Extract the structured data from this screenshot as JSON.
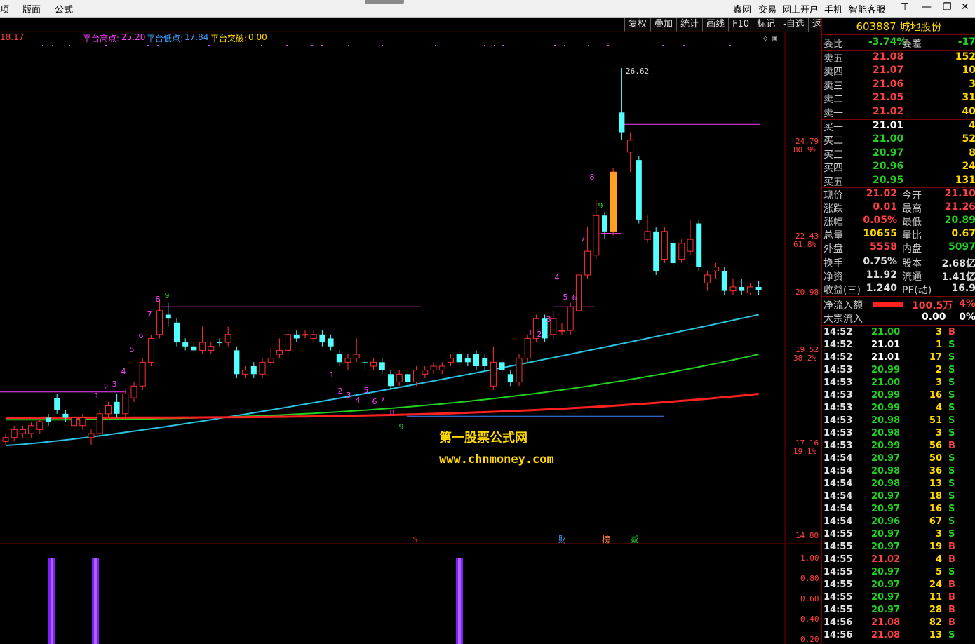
{
  "menu": {
    "items": [
      "项",
      "版面",
      "公式"
    ],
    "right_items": [
      "鑫网",
      "交易",
      "网上开户",
      "手机",
      "智能客服"
    ],
    "win_icons": [
      "pin-icon",
      "minimize-icon",
      "restore-icon",
      "close-icon"
    ]
  },
  "toolbar": {
    "buttons": [
      "复权",
      "叠加",
      "统计",
      "画线",
      "F10",
      "标记",
      "-自选",
      "返回"
    ]
  },
  "legend": {
    "first_value": "18.17",
    "high_label": "平台高点:",
    "high_value": "25.20",
    "low_label": "平台低点:",
    "low_value": "17.84",
    "break_label": "平台突破:",
    "break_value": "0.00"
  },
  "price_axis": [
    {
      "price": "24.79",
      "pct": "80.9%"
    },
    {
      "price": "22.43",
      "pct": "61.8%"
    },
    {
      "price": "20.98",
      "pct": ""
    },
    {
      "price": "19.52",
      "pct": "38.2%"
    },
    {
      "price": "17.16",
      "pct": "19.1%"
    },
    {
      "price": "14.80",
      "pct": ""
    }
  ],
  "indicator_axis": [
    "1.00",
    "0.80",
    "0.60",
    "0.40",
    "0.20"
  ],
  "chart_labels": {
    "peak": "26.62",
    "events": [
      "$",
      "财",
      "榜",
      "减"
    ]
  },
  "watermark": {
    "line1": "第一股票公式网",
    "line2": "www.chnmoney.com"
  },
  "chart_data": {
    "type": "candlestick",
    "price_range": [
      14.8,
      26.62
    ],
    "peak_high": 26.62,
    "reference_levels": [
      25.2,
      21.02,
      17.84
    ],
    "moving_averages": [
      {
        "color": "#2ac3e0",
        "approx_end": 20.4
      },
      {
        "color": "#22d022",
        "approx_end": 19.4
      },
      {
        "color": "#ff2020",
        "approx_end": 18.4
      }
    ],
    "candles": [
      {
        "o": 17.2,
        "c": 17.3,
        "h": 17.4,
        "l": 17.1,
        "up": true
      },
      {
        "o": 17.3,
        "c": 17.5,
        "h": 17.6,
        "l": 17.2,
        "up": true
      },
      {
        "o": 17.5,
        "c": 17.4,
        "h": 17.6,
        "l": 17.3,
        "up": true
      },
      {
        "o": 17.4,
        "c": 17.6,
        "h": 17.7,
        "l": 17.3,
        "up": true
      },
      {
        "o": 17.5,
        "c": 17.7,
        "h": 17.8,
        "l": 17.4,
        "up": true
      },
      {
        "o": 17.7,
        "c": 17.8,
        "h": 17.9,
        "l": 17.6,
        "up": false
      },
      {
        "o": 18.3,
        "c": 18.0,
        "h": 18.4,
        "l": 17.9,
        "up": false
      },
      {
        "o": 17.9,
        "c": 17.8,
        "h": 18.0,
        "l": 17.7,
        "up": false
      },
      {
        "o": 17.6,
        "c": 17.8,
        "h": 17.9,
        "l": 17.4,
        "up": true
      },
      {
        "o": 17.6,
        "c": 17.8,
        "h": 17.9,
        "l": 17.5,
        "up": true
      },
      {
        "o": 17.4,
        "c": 17.3,
        "h": 17.5,
        "l": 17.1,
        "up": true
      },
      {
        "o": 17.4,
        "c": 17.9,
        "h": 18.0,
        "l": 17.3,
        "up": true
      },
      {
        "o": 17.9,
        "c": 18.1,
        "h": 18.2,
        "l": 17.8,
        "up": true
      },
      {
        "o": 17.9,
        "c": 18.2,
        "h": 18.4,
        "l": 17.8,
        "up": false
      },
      {
        "o": 17.9,
        "c": 18.4,
        "h": 18.5,
        "l": 17.8,
        "up": true
      },
      {
        "o": 18.3,
        "c": 18.6,
        "h": 18.7,
        "l": 18.2,
        "up": true
      },
      {
        "o": 18.6,
        "c": 19.2,
        "h": 19.3,
        "l": 18.5,
        "up": true
      },
      {
        "o": 19.2,
        "c": 19.8,
        "h": 19.9,
        "l": 19.1,
        "up": true
      },
      {
        "o": 19.9,
        "c": 20.5,
        "h": 20.8,
        "l": 19.8,
        "up": true
      },
      {
        "o": 20.4,
        "c": 20.3,
        "h": 20.7,
        "l": 20.1,
        "up": false
      },
      {
        "o": 20.2,
        "c": 19.7,
        "h": 20.3,
        "l": 19.6,
        "up": false
      },
      {
        "o": 19.7,
        "c": 19.6,
        "h": 19.8,
        "l": 19.5,
        "up": false
      },
      {
        "o": 19.5,
        "c": 19.6,
        "h": 19.7,
        "l": 19.4,
        "up": false
      },
      {
        "o": 19.5,
        "c": 19.7,
        "h": 20.1,
        "l": 19.4,
        "up": true
      },
      {
        "o": 19.5,
        "c": 19.6,
        "h": 19.7,
        "l": 19.4,
        "up": true
      },
      {
        "o": 19.7,
        "c": 19.7,
        "h": 19.8,
        "l": 19.6,
        "up": false
      },
      {
        "o": 19.7,
        "c": 19.9,
        "h": 20.1,
        "l": 19.6,
        "up": true
      },
      {
        "o": 19.5,
        "c": 18.9,
        "h": 19.6,
        "l": 18.8,
        "up": false
      },
      {
        "o": 18.9,
        "c": 19.0,
        "h": 19.1,
        "l": 18.8,
        "up": true
      },
      {
        "o": 19.1,
        "c": 18.9,
        "h": 19.2,
        "l": 18.8,
        "up": false
      },
      {
        "o": 18.9,
        "c": 19.2,
        "h": 19.3,
        "l": 18.8,
        "up": true
      },
      {
        "o": 19.3,
        "c": 19.2,
        "h": 19.6,
        "l": 19.1,
        "up": true
      },
      {
        "o": 19.5,
        "c": 19.4,
        "h": 19.8,
        "l": 19.3,
        "up": true
      },
      {
        "o": 19.9,
        "c": 19.5,
        "h": 20.0,
        "l": 19.3,
        "up": true
      },
      {
        "o": 19.8,
        "c": 19.9,
        "h": 20.0,
        "l": 19.7,
        "up": false
      },
      {
        "o": 19.9,
        "c": 19.9,
        "h": 20.0,
        "l": 19.8,
        "up": true
      },
      {
        "o": 19.8,
        "c": 19.9,
        "h": 20.0,
        "l": 19.7,
        "up": true
      },
      {
        "o": 19.9,
        "c": 19.7,
        "h": 20.0,
        "l": 19.6,
        "up": false
      },
      {
        "o": 19.8,
        "c": 19.6,
        "h": 19.9,
        "l": 19.5,
        "up": false
      },
      {
        "o": 19.4,
        "c": 19.2,
        "h": 19.5,
        "l": 19.1,
        "up": false
      },
      {
        "o": 19.2,
        "c": 19.3,
        "h": 19.4,
        "l": 19.0,
        "up": true
      },
      {
        "o": 19.4,
        "c": 19.3,
        "h": 19.8,
        "l": 19.2,
        "up": true
      },
      {
        "o": 19.2,
        "c": 19.2,
        "h": 19.3,
        "l": 19.0,
        "up": false
      },
      {
        "o": 19.1,
        "c": 19.2,
        "h": 19.3,
        "l": 19.0,
        "up": true
      },
      {
        "o": 19.2,
        "c": 19.0,
        "h": 19.3,
        "l": 18.9,
        "up": false
      },
      {
        "o": 18.9,
        "c": 18.6,
        "h": 19.0,
        "l": 18.5,
        "up": false
      },
      {
        "o": 18.7,
        "c": 18.9,
        "h": 19.0,
        "l": 18.6,
        "up": true
      },
      {
        "o": 18.9,
        "c": 18.7,
        "h": 19.0,
        "l": 18.6,
        "up": false
      },
      {
        "o": 18.7,
        "c": 19.0,
        "h": 19.1,
        "l": 18.6,
        "up": true
      },
      {
        "o": 18.9,
        "c": 19.0,
        "h": 19.1,
        "l": 18.8,
        "up": true
      },
      {
        "o": 19.0,
        "c": 19.1,
        "h": 19.2,
        "l": 18.9,
        "up": true
      },
      {
        "o": 19.0,
        "c": 19.1,
        "h": 19.2,
        "l": 18.9,
        "up": true
      },
      {
        "o": 19.2,
        "c": 19.3,
        "h": 19.4,
        "l": 19.1,
        "up": true
      },
      {
        "o": 19.4,
        "c": 19.2,
        "h": 19.5,
        "l": 19.1,
        "up": false
      },
      {
        "o": 19.3,
        "c": 19.2,
        "h": 19.4,
        "l": 19.1,
        "up": false
      },
      {
        "o": 19.4,
        "c": 19.1,
        "h": 19.5,
        "l": 19.0,
        "up": false
      },
      {
        "o": 19.3,
        "c": 19.1,
        "h": 19.4,
        "l": 19.0,
        "up": false
      },
      {
        "o": 18.6,
        "c": 19.2,
        "h": 19.6,
        "l": 18.5,
        "up": true
      },
      {
        "o": 19.2,
        "c": 19.0,
        "h": 19.3,
        "l": 18.9,
        "up": false
      },
      {
        "o": 18.9,
        "c": 18.7,
        "h": 19.0,
        "l": 18.6,
        "up": false
      },
      {
        "o": 18.7,
        "c": 19.3,
        "h": 19.4,
        "l": 18.6,
        "up": true
      },
      {
        "o": 19.3,
        "c": 19.8,
        "h": 19.9,
        "l": 19.2,
        "up": true
      },
      {
        "o": 19.8,
        "c": 20.3,
        "h": 20.4,
        "l": 19.7,
        "up": true
      },
      {
        "o": 20.3,
        "c": 19.8,
        "h": 20.4,
        "l": 19.7,
        "up": false
      },
      {
        "o": 19.9,
        "c": 20.3,
        "h": 20.5,
        "l": 19.8,
        "up": true
      },
      {
        "o": 20.0,
        "c": 20.0,
        "h": 20.2,
        "l": 19.9,
        "up": true
      },
      {
        "o": 20.0,
        "c": 20.6,
        "h": 20.7,
        "l": 19.9,
        "up": true
      },
      {
        "o": 20.5,
        "c": 21.4,
        "h": 21.5,
        "l": 20.4,
        "up": true
      },
      {
        "o": 21.4,
        "c": 22.0,
        "h": 22.6,
        "l": 21.3,
        "up": true
      },
      {
        "o": 21.9,
        "c": 22.9,
        "h": 23.3,
        "l": 21.8,
        "up": true
      },
      {
        "o": 22.5,
        "c": 22.9,
        "h": 23.0,
        "l": 22.3,
        "up": false
      },
      {
        "o": 22.5,
        "c": 24.0,
        "h": 24.1,
        "l": 22.4,
        "up": true
      },
      {
        "o": 25.5,
        "c": 25.0,
        "h": 26.62,
        "l": 24.8,
        "up": false
      },
      {
        "o": 24.5,
        "c": 24.8,
        "h": 25.0,
        "l": 24.0,
        "up": true
      },
      {
        "o": 24.3,
        "c": 22.8,
        "h": 24.4,
        "l": 22.7,
        "up": false
      },
      {
        "o": 22.5,
        "c": 22.3,
        "h": 22.9,
        "l": 22.2,
        "up": true
      },
      {
        "o": 22.5,
        "c": 21.5,
        "h": 22.6,
        "l": 21.4,
        "up": false
      },
      {
        "o": 21.8,
        "c": 22.5,
        "h": 22.6,
        "l": 21.7,
        "up": true
      },
      {
        "o": 22.2,
        "c": 21.7,
        "h": 22.3,
        "l": 21.6,
        "up": false
      },
      {
        "o": 21.8,
        "c": 22.2,
        "h": 22.3,
        "l": 21.7,
        "up": true
      },
      {
        "o": 22.0,
        "c": 22.3,
        "h": 22.8,
        "l": 21.9,
        "up": true
      },
      {
        "o": 22.7,
        "c": 21.6,
        "h": 22.8,
        "l": 21.5,
        "up": false
      },
      {
        "o": 21.4,
        "c": 21.2,
        "h": 21.5,
        "l": 21.0,
        "up": true
      },
      {
        "o": 21.5,
        "c": 21.6,
        "h": 21.7,
        "l": 21.3,
        "up": true
      },
      {
        "o": 21.5,
        "c": 21.0,
        "h": 21.6,
        "l": 20.9,
        "up": false
      },
      {
        "o": 21.0,
        "c": 21.1,
        "h": 21.3,
        "l": 20.9,
        "up": true
      },
      {
        "o": 21.1,
        "c": 21.0,
        "h": 21.3,
        "l": 20.9,
        "up": false
      },
      {
        "o": 20.95,
        "c": 21.1,
        "h": 21.2,
        "l": 20.9,
        "up": true
      },
      {
        "o": 21.1,
        "c": 21.02,
        "h": 21.26,
        "l": 20.89,
        "up": false
      }
    ]
  },
  "quote": {
    "code": "603887",
    "name": "城地股份",
    "wei_bi": {
      "label": "委比",
      "value": "-3.74%"
    },
    "wei_cha": {
      "label": "委差",
      "value": "-17"
    },
    "sell": [
      {
        "label": "卖五",
        "price": "21.08",
        "vol": "152"
      },
      {
        "label": "卖四",
        "price": "21.07",
        "vol": "10"
      },
      {
        "label": "卖三",
        "price": "21.06",
        "vol": "3"
      },
      {
        "label": "卖二",
        "price": "21.05",
        "vol": "31"
      },
      {
        "label": "卖一",
        "price": "21.02",
        "vol": "40"
      }
    ],
    "buy": [
      {
        "label": "买一",
        "price": "21.01",
        "vol": "4"
      },
      {
        "label": "买二",
        "price": "21.00",
        "vol": "52"
      },
      {
        "label": "买三",
        "price": "20.97",
        "vol": "8"
      },
      {
        "label": "买四",
        "price": "20.96",
        "vol": "24"
      },
      {
        "label": "买五",
        "price": "20.95",
        "vol": "131"
      }
    ],
    "stats": [
      {
        "l1": "现价",
        "v1": "21.02",
        "l2": "今开",
        "v2": "21.10",
        "c1": "#ff4040",
        "c2": "#ff4040"
      },
      {
        "l1": "涨跌",
        "v1": "0.01",
        "l2": "最高",
        "v2": "21.26",
        "c1": "#ff4040",
        "c2": "#ff4040"
      },
      {
        "l1": "涨幅",
        "v1": "0.05%",
        "l2": "最低",
        "v2": "20.89",
        "c1": "#ff4040",
        "c2": "#22d022"
      },
      {
        "l1": "总量",
        "v1": "10655",
        "l2": "量比",
        "v2": "0.67",
        "c1": "#ffd800",
        "c2": "#ffd800"
      },
      {
        "l1": "外盘",
        "v1": "5558",
        "l2": "内盘",
        "v2": "5097",
        "c1": "#ff4040",
        "c2": "#22d022"
      }
    ],
    "fund": [
      {
        "l1": "换手",
        "v1": "0.75%",
        "l2": "股本",
        "v2": "2.68亿"
      },
      {
        "l1": "净资",
        "v1": "11.92",
        "l2": "流通",
        "v2": "1.41亿"
      },
      {
        "l1": "收益(三)",
        "v1": "1.240",
        "l2": "PE(动)",
        "v2": "16.9"
      }
    ],
    "flow": {
      "label1": "净流入额",
      "value1": "100.5万",
      "pct1": "4%",
      "label2": "大宗流入",
      "value2": "0.00",
      "pct2": "0%"
    }
  },
  "ticks": [
    {
      "t": "14:52",
      "p": "21.00",
      "v": "3",
      "s": "B",
      "pc": "#22d022"
    },
    {
      "t": "14:52",
      "p": "21.01",
      "v": "1",
      "s": "S",
      "pc": "#ffffff"
    },
    {
      "t": "14:52",
      "p": "21.01",
      "v": "17",
      "s": "S",
      "pc": "#ffffff"
    },
    {
      "t": "14:53",
      "p": "20.99",
      "v": "2",
      "s": "S",
      "pc": "#22d022"
    },
    {
      "t": "14:53",
      "p": "21.00",
      "v": "3",
      "s": "S",
      "pc": "#22d022"
    },
    {
      "t": "14:53",
      "p": "20.99",
      "v": "16",
      "s": "S",
      "pc": "#22d022"
    },
    {
      "t": "14:53",
      "p": "20.99",
      "v": "4",
      "s": "S",
      "pc": "#22d022"
    },
    {
      "t": "14:53",
      "p": "20.98",
      "v": "51",
      "s": "S",
      "pc": "#22d022"
    },
    {
      "t": "14:53",
      "p": "20.98",
      "v": "3",
      "s": "S",
      "pc": "#22d022"
    },
    {
      "t": "14:53",
      "p": "20.99",
      "v": "56",
      "s": "B",
      "pc": "#22d022"
    },
    {
      "t": "14:54",
      "p": "20.97",
      "v": "50",
      "s": "S",
      "pc": "#22d022"
    },
    {
      "t": "14:54",
      "p": "20.98",
      "v": "36",
      "s": "S",
      "pc": "#22d022"
    },
    {
      "t": "14:54",
      "p": "20.98",
      "v": "13",
      "s": "S",
      "pc": "#22d022"
    },
    {
      "t": "14:54",
      "p": "20.97",
      "v": "18",
      "s": "S",
      "pc": "#22d022"
    },
    {
      "t": "14:54",
      "p": "20.97",
      "v": "16",
      "s": "S",
      "pc": "#22d022"
    },
    {
      "t": "14:54",
      "p": "20.96",
      "v": "67",
      "s": "S",
      "pc": "#22d022"
    },
    {
      "t": "14:55",
      "p": "20.97",
      "v": "3",
      "s": "S",
      "pc": "#22d022"
    },
    {
      "t": "14:55",
      "p": "20.97",
      "v": "19",
      "s": "B",
      "pc": "#22d022"
    },
    {
      "t": "14:55",
      "p": "21.02",
      "v": "4",
      "s": "B",
      "pc": "#ff4040"
    },
    {
      "t": "14:55",
      "p": "20.97",
      "v": "5",
      "s": "S",
      "pc": "#22d022"
    },
    {
      "t": "14:55",
      "p": "20.97",
      "v": "24",
      "s": "B",
      "pc": "#22d022"
    },
    {
      "t": "14:55",
      "p": "20.97",
      "v": "11",
      "s": "B",
      "pc": "#22d022"
    },
    {
      "t": "14:55",
      "p": "20.97",
      "v": "28",
      "s": "B",
      "pc": "#22d022"
    },
    {
      "t": "14:56",
      "p": "21.08",
      "v": "82",
      "s": "B",
      "pc": "#ff4040"
    },
    {
      "t": "14:56",
      "p": "21.08",
      "v": "13",
      "s": "S",
      "pc": "#ff4040"
    }
  ]
}
